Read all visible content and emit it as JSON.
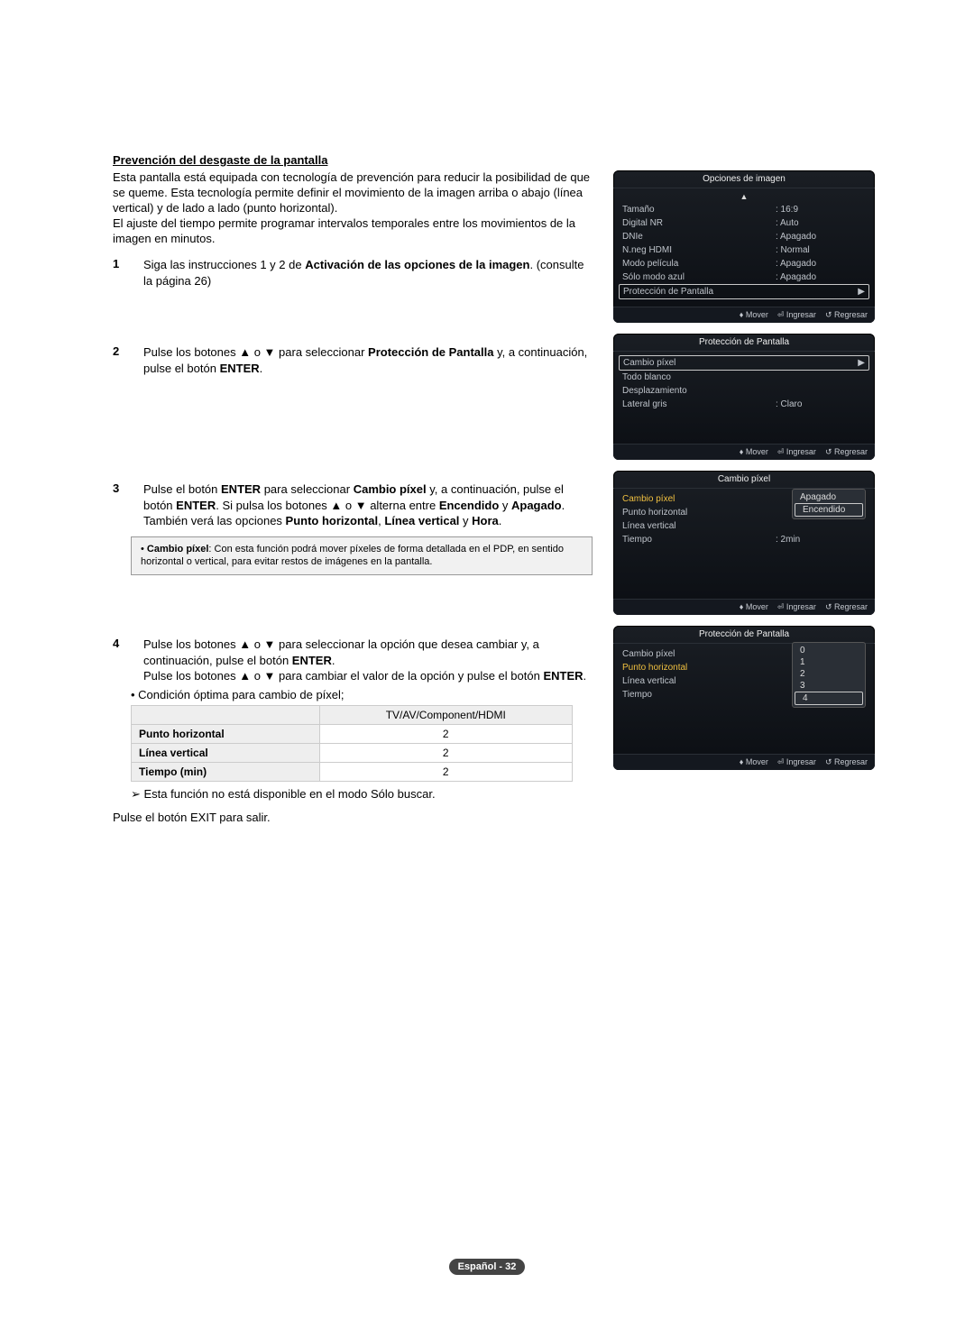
{
  "section_title": "Prevención del desgaste de la pantalla",
  "intro_p1": "Esta pantalla está equipada con tecnología de prevención para reducir la posibilidad de que se queme. Esta tecnología permite definir el movimiento de la imagen arriba o abajo (línea vertical) y de lado a lado (punto horizontal).",
  "intro_p2": "El ajuste del tiempo permite programar intervalos temporales entre los movimientos de la imagen en minutos.",
  "step1_a": "Siga las instrucciones 1 y 2 de ",
  "step1_b": "Activación de las opciones de la imagen",
  "step1_c": ". (consulte la página 26)",
  "step2_a": "Pulse los botones ▲ o ▼ para seleccionar ",
  "step2_b": "Protección de Pantalla",
  "step2_c": " y, a continuación, pulse el botón ",
  "step2_d": "ENTER",
  "step2_e": ".",
  "step3_a": "Pulse el botón ",
  "step3_b": "ENTER",
  "step3_c": " para seleccionar ",
  "step3_d": "Cambio píxel",
  "step3_e": " y, a continuación, pulse el botón ",
  "step3_f": "ENTER",
  "step3_g": ". Si pulsa los botones ▲ o ▼ alterna entre ",
  "step3_h": "Encendido",
  "step3_i": " y ",
  "step3_j": "Apagado",
  "step3_k": ". También verá las opciones ",
  "step3_l": "Punto horizontal",
  "step3_m": ", ",
  "step3_n": "Línea vertical",
  "step3_o": " y ",
  "step3_p": "Hora",
  "step3_q": ".",
  "note_a": "• ",
  "note_b": "Cambio píxel",
  "note_c": ": Con esta función podrá mover píxeles de forma detallada en el PDP, en sentido horizontal o vertical, para evitar restos de imágenes en la pantalla.",
  "step4_a": "Pulse los botones ▲ o ▼ para seleccionar la opción que desea cambiar y, a continuación, pulse el botón ",
  "step4_b": "ENTER",
  "step4_c": ".",
  "step4_d": "Pulse los botones ▲ o ▼ para cambiar el valor de la opción y pulse el botón ",
  "step4_e": "ENTER",
  "step4_f": ".",
  "bullet": "• Condición óptima para cambio de píxel;",
  "table": {
    "col2": "TV/AV/Component/HDMI",
    "r1": "Punto horizontal",
    "r1v": "2",
    "r2": "Línea vertical",
    "r2v": "2",
    "r3": "Tiempo (min)",
    "r3v": "2"
  },
  "arrow_line": "➢  Esta función no está disponible en el modo Sólo buscar.",
  "exit_a": "Pulse el botón ",
  "exit_b": "EXIT",
  "exit_c": " para salir.",
  "osd1": {
    "title": "Opciones de imagen",
    "rows": [
      {
        "label": "Tamaño",
        "val": ": 16:9"
      },
      {
        "label": "Digital NR",
        "val": ": Auto"
      },
      {
        "label": "DNIe",
        "val": ": Apagado"
      },
      {
        "label": "N.neg HDMI",
        "val": ": Normal"
      },
      {
        "label": "Modo película",
        "val": ": Apagado"
      },
      {
        "label": "Sólo modo azul",
        "val": ": Apagado"
      },
      {
        "label": "Protección de Pantalla",
        "val": "",
        "sel": true,
        "chevron": true
      }
    ]
  },
  "osd2": {
    "title": "Protección de Pantalla",
    "rows": [
      {
        "label": "Cambio píxel",
        "val": "",
        "sel": true,
        "chevron": true
      },
      {
        "label": "Todo blanco",
        "val": ""
      },
      {
        "label": "Desplazamiento",
        "val": ""
      },
      {
        "label": "Lateral gris",
        "val": ": Claro"
      }
    ]
  },
  "osd3": {
    "title": "Cambio píxel",
    "rows": [
      {
        "label": "Cambio píxel",
        "val": "",
        "active": true
      },
      {
        "label": "Punto horizontal",
        "val": ""
      },
      {
        "label": "Línea vertical",
        "val": ""
      },
      {
        "label": "Tiempo",
        "val": ": 2min"
      }
    ],
    "dropdown": [
      "Apagado",
      "Encendido"
    ],
    "dropdown_sel": 1
  },
  "osd4": {
    "title": "Protección de Pantalla",
    "rows": [
      {
        "label": "Cambio píxel",
        "val": ""
      },
      {
        "label": "Punto horizontal",
        "val": "",
        "active": true
      },
      {
        "label": "Línea vertical",
        "val": ""
      },
      {
        "label": "Tiempo",
        "val": ""
      }
    ],
    "dropdown": [
      "0",
      "1",
      "2",
      "3",
      "4"
    ],
    "dropdown_sel": 4
  },
  "osd_footer": {
    "mover": "Mover",
    "ingresar": "Ingresar",
    "regresar": "Regresar"
  },
  "page_num": "Español - 32"
}
